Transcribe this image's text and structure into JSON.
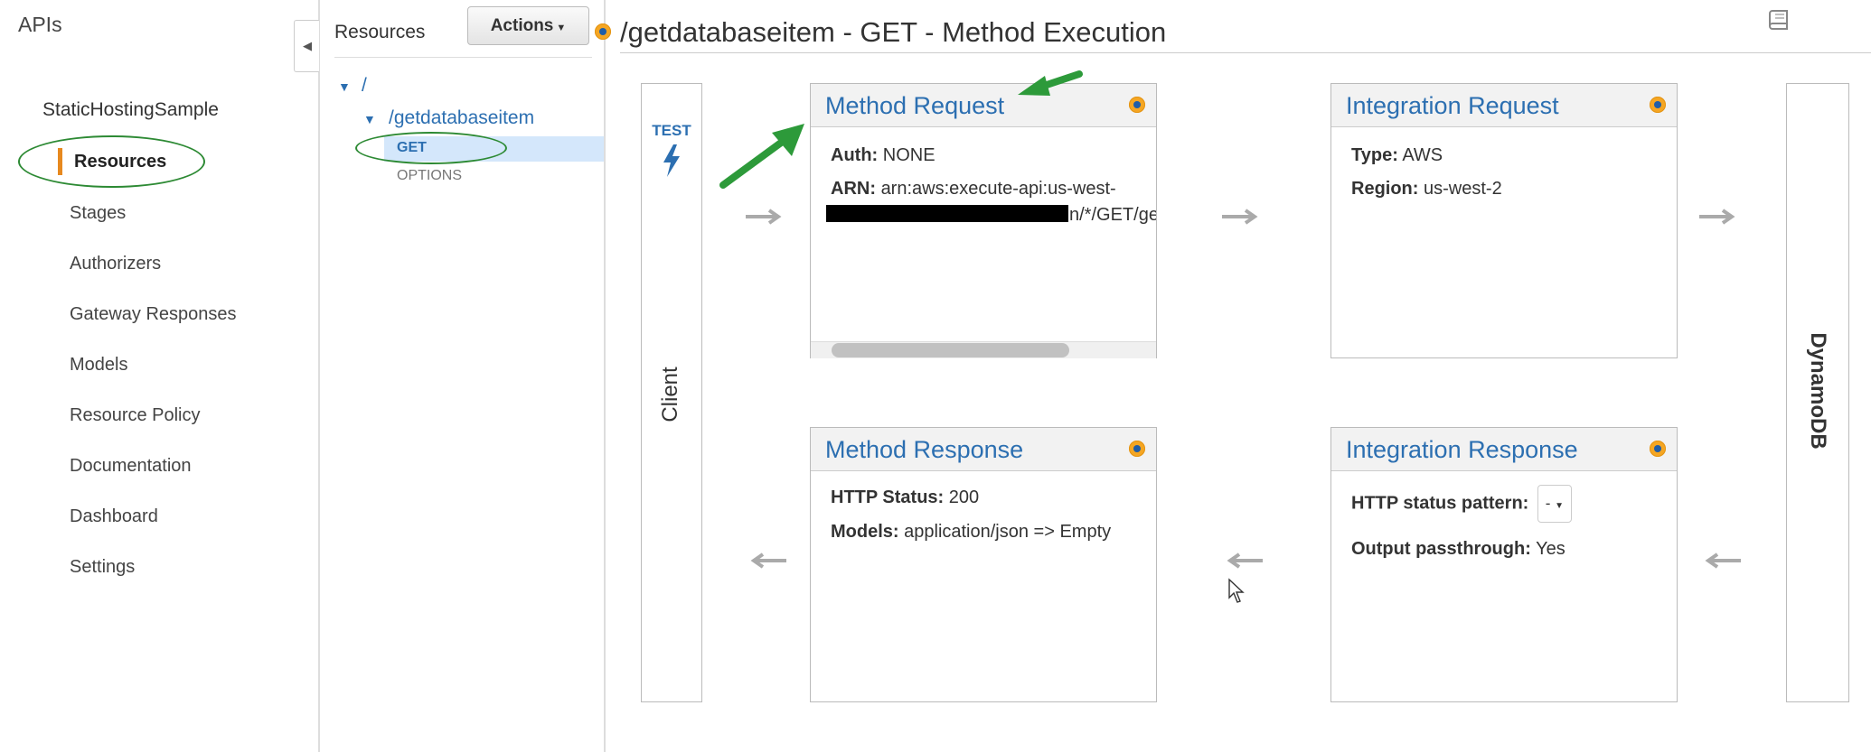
{
  "nav": {
    "title": "APIs",
    "api_name": "StaticHostingSample",
    "active": "Resources",
    "items": [
      "Stages",
      "Authorizers",
      "Gateway Responses",
      "Models",
      "Resource Policy",
      "Documentation",
      "Dashboard",
      "Settings"
    ]
  },
  "resources": {
    "title": "Resources",
    "actions_label": "Actions",
    "tree": {
      "root": "/",
      "child": "/getdatabaseitem",
      "methods": [
        "GET",
        "OPTIONS"
      ]
    }
  },
  "main": {
    "page_title": "/getdatabaseitem - GET - Method Execution",
    "client": {
      "test_label": "TEST",
      "label": "Client"
    },
    "backend": {
      "label": "DynamoDB"
    },
    "method_request": {
      "title": "Method Request",
      "auth_key": "Auth:",
      "auth_value": "NONE",
      "arn_key": "ARN:",
      "arn_value": "arn:aws:execute-api:us-west-",
      "arn_tail": "n/*/GET/ge"
    },
    "integration_request": {
      "title": "Integration Request",
      "type_key": "Type:",
      "type_value": "AWS",
      "region_key": "Region:",
      "region_value": "us-west-2"
    },
    "method_response": {
      "title": "Method Response",
      "status_key": "HTTP Status:",
      "status_value": "200",
      "models_key": "Models:",
      "models_value": "application/json => Empty"
    },
    "integration_response": {
      "title": "Integration Response",
      "pattern_key": "HTTP status pattern:",
      "pattern_value": "-",
      "passthrough_key": "Output passthrough:",
      "passthrough_value": "Yes"
    }
  },
  "colors": {
    "link": "#2c6fb1",
    "accent": "#e7891f",
    "annotation": "#2d8a34",
    "selected_row": "#d4e7fb"
  }
}
